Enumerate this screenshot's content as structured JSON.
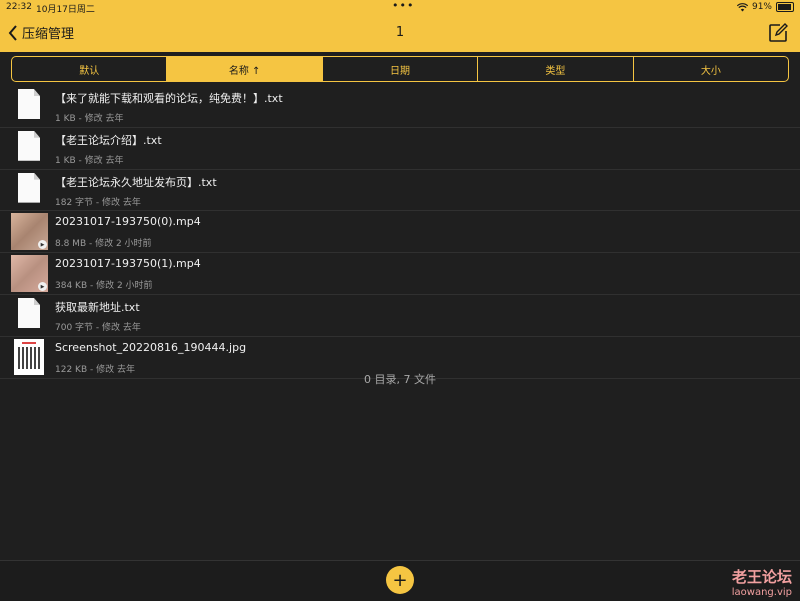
{
  "status": {
    "time": "22:32",
    "date": "10月17日周二",
    "dots": "•••",
    "battery_text": "91%",
    "battery_level": 0.91
  },
  "nav": {
    "back_label": "压缩管理",
    "title": "1"
  },
  "sort_tabs": [
    {
      "label": "默认",
      "active": false
    },
    {
      "label": "名称 ↑",
      "active": true
    },
    {
      "label": "日期",
      "active": false
    },
    {
      "label": "类型",
      "active": false
    },
    {
      "label": "大小",
      "active": false
    }
  ],
  "files": [
    {
      "name": "【来了就能下载和观看的论坛，纯免费！】.txt",
      "meta": "1 KB - 修改 去年",
      "kind": "text-file-icon"
    },
    {
      "name": "【老王论坛介绍】.txt",
      "meta": "1 KB - 修改 去年",
      "kind": "text-file-icon"
    },
    {
      "name": "【老王论坛永久地址发布页】.txt",
      "meta": "182 字节 - 修改 去年",
      "kind": "text-file-icon"
    },
    {
      "name": "20231017-193750(0).mp4",
      "meta": "8.8 MB - 修改 2 小时前",
      "kind": "video-thumbnail"
    },
    {
      "name": "20231017-193750(1).mp4",
      "meta": "384 KB - 修改 2 小时前",
      "kind": "video-thumbnail"
    },
    {
      "name": "获取最新地址.txt",
      "meta": "700 字节 - 修改 去年",
      "kind": "text-file-icon"
    },
    {
      "name": "Screenshot_20220816_190444.jpg",
      "meta": "122 KB - 修改 去年",
      "kind": "image-thumbnail"
    }
  ],
  "summary": "0 目录, 7 文件",
  "fab_label": "+",
  "watermark": {
    "line1": "老王论坛",
    "line2": "laowang.vip"
  },
  "colors": {
    "accent": "#f5c542",
    "background": "#1f1f1f"
  }
}
